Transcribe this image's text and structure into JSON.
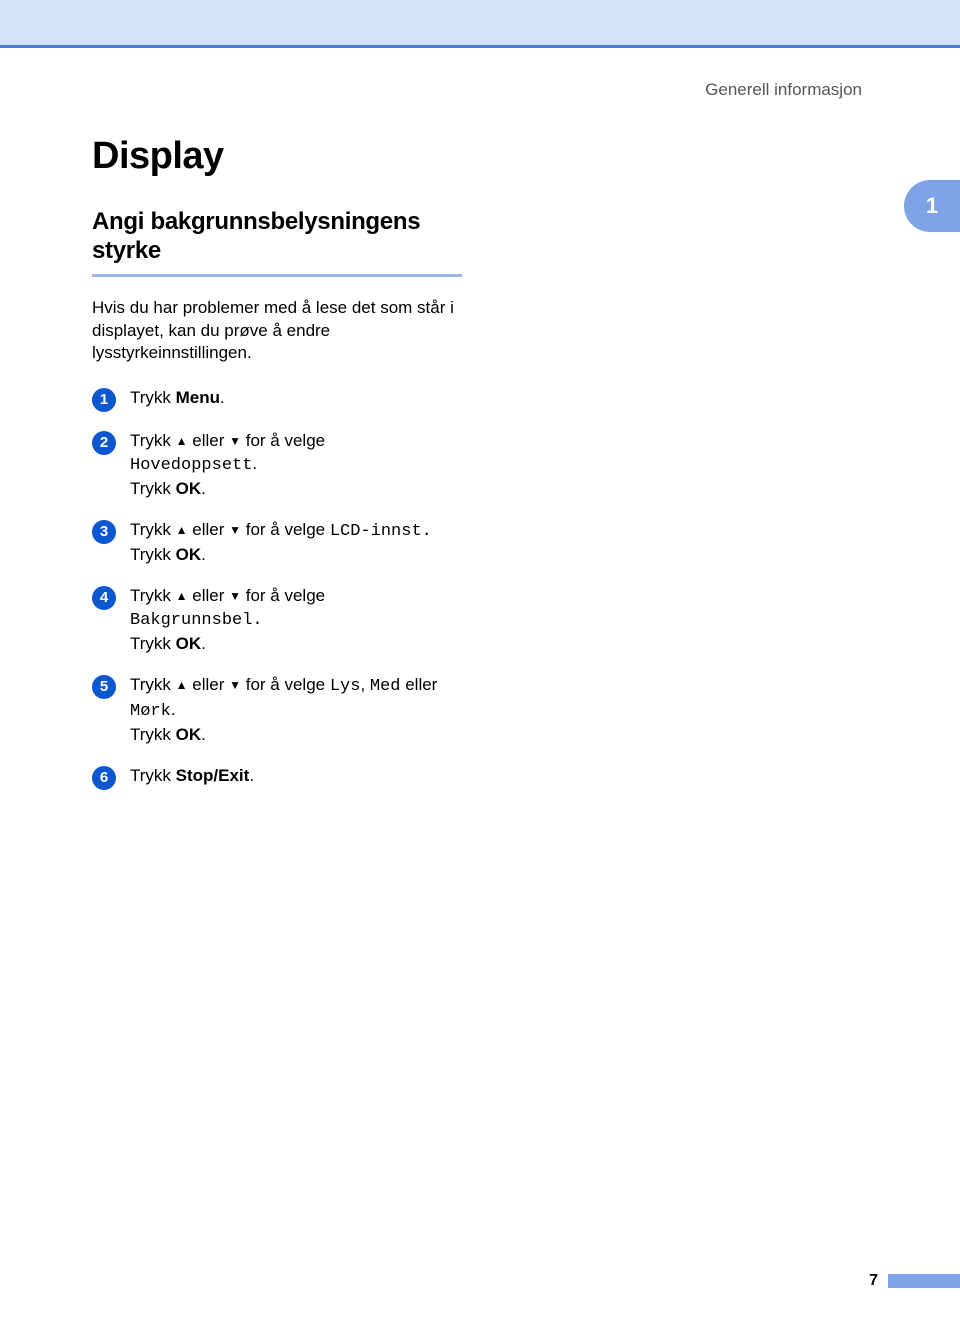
{
  "header": {
    "section_label": "Generell informasjon"
  },
  "side_tab": "1",
  "title": "Display",
  "subtitle": "Angi bakgrunnsbelysningens styrke",
  "intro": "Hvis du har problemer med å lese det som står i displayet, kan du prøve å endre lysstyrkeinnstillingen.",
  "glyphs": {
    "up": "▲",
    "down": "▼"
  },
  "steps": [
    {
      "num": "1",
      "prefix": "Trykk ",
      "bold1": "Menu",
      "suffix": "."
    },
    {
      "num": "2",
      "prefix": "Trykk ",
      "mid": " eller ",
      "after_arrows": " for å velge ",
      "mono": "Hovedoppsett",
      "mono_suffix": ".",
      "line2_prefix": "Trykk ",
      "line2_bold": "OK",
      "line2_suffix": "."
    },
    {
      "num": "3",
      "prefix": "Trykk ",
      "mid": " eller ",
      "after_arrows": " for å velge ",
      "mono": "LCD-innst.",
      "line2_prefix": "Trykk ",
      "line2_bold": "OK",
      "line2_suffix": "."
    },
    {
      "num": "4",
      "prefix": "Trykk ",
      "mid": " eller ",
      "after_arrows": " for å velge ",
      "mono": "Bakgrunnsbel.",
      "line2_prefix": "Trykk ",
      "line2_bold": "OK",
      "line2_suffix": "."
    },
    {
      "num": "5",
      "prefix": "Trykk ",
      "mid": " eller ",
      "after_arrows": " for å velge ",
      "mono1": "Lys",
      "sep1": ", ",
      "mono2": "Med",
      "sep2": " eller ",
      "mono3": "Mørk",
      "mono_suffix": ".",
      "line2_prefix": "Trykk ",
      "line2_bold": "OK",
      "line2_suffix": "."
    },
    {
      "num": "6",
      "prefix": "Trykk ",
      "bold1": "Stop/Exit",
      "suffix": "."
    }
  ],
  "page_number": "7"
}
